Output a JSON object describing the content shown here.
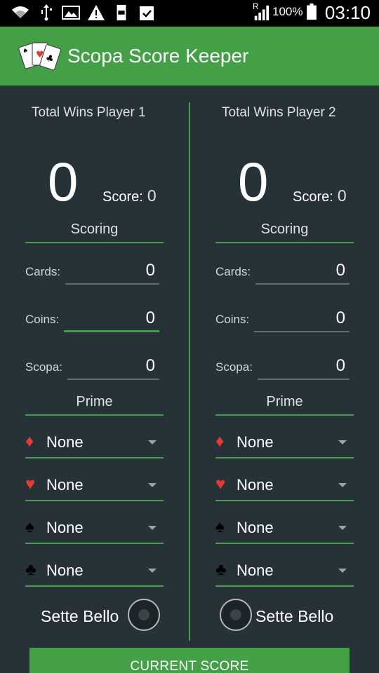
{
  "status_bar": {
    "signal_label": "R",
    "battery_text": "100%",
    "time": "03:10",
    "icons": [
      "wifi-icon",
      "usb-icon",
      "image-icon",
      "warning-icon",
      "storage-icon",
      "clipboard-check-icon",
      "signal-icon",
      "battery-icon"
    ]
  },
  "app_bar": {
    "title": "Scopa Score Keeper",
    "background": "#43a047"
  },
  "players": [
    {
      "wins_title": "Total Wins Player 1",
      "wins": "0",
      "score_label": "Score:",
      "score": "0",
      "scoring_title": "Scoring",
      "cards_label": "Cards:",
      "cards": "0",
      "coins_label": "Coins:",
      "coins": "0",
      "scopa_label": "Scopa:",
      "scopa": "0",
      "prime_title": "Prime",
      "prime": [
        {
          "suit": "diamond-icon",
          "value": "None"
        },
        {
          "suit": "heart-icon",
          "value": "None"
        },
        {
          "suit": "spade-icon",
          "value": "None"
        },
        {
          "suit": "club-icon",
          "value": "None"
        }
      ],
      "sette_bello_label": "Sette Bello"
    },
    {
      "wins_title": "Total Wins Player 2",
      "wins": "0",
      "score_label": "Score:",
      "score": "0",
      "scoring_title": "Scoring",
      "cards_label": "Cards:",
      "cards": "0",
      "coins_label": "Coins:",
      "coins": "0",
      "scopa_label": "Scopa:",
      "scopa": "0",
      "prime_title": "Prime",
      "prime": [
        {
          "suit": "diamond-icon",
          "value": "None"
        },
        {
          "suit": "heart-icon",
          "value": "None"
        },
        {
          "suit": "spade-icon",
          "value": "None"
        },
        {
          "suit": "club-icon",
          "value": "None"
        }
      ],
      "sette_bello_label": "Sette Bello"
    }
  ],
  "actions": {
    "current_score_label": "CURRENT SCORE"
  },
  "colors": {
    "background": "#263238",
    "accent": "#43a047",
    "suit_red": "#e53935"
  }
}
